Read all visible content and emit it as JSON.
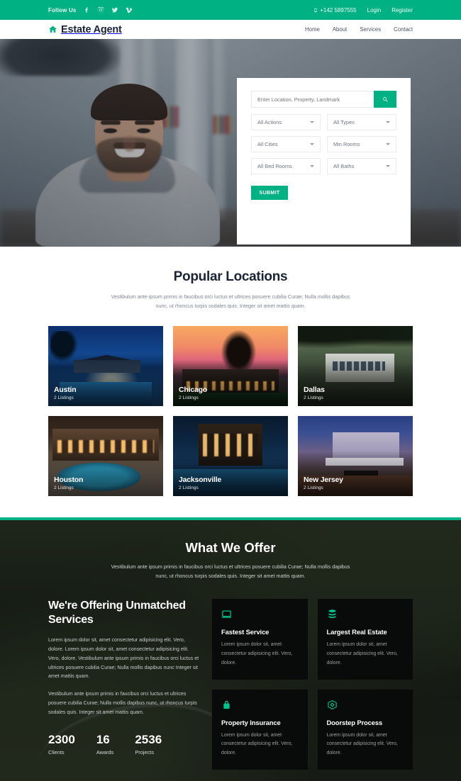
{
  "topbar": {
    "follow_label": "Follow Us",
    "socials": [
      {
        "name": "facebook-icon"
      },
      {
        "name": "instagram-icon"
      },
      {
        "name": "twitter-icon"
      },
      {
        "name": "vimeo-icon"
      }
    ],
    "phone": "+142 5897555",
    "login": "Login",
    "register": "Register",
    "bg_color": "#00b183"
  },
  "header": {
    "logo_text": "Estate Agent",
    "logo_icon": "home-icon",
    "nav": [
      {
        "label": "Home"
      },
      {
        "label": "About"
      },
      {
        "label": "Services"
      },
      {
        "label": "Contact"
      }
    ]
  },
  "hero": {
    "search": {
      "placeholder": "Enter Location, Property, Landmark",
      "value": "",
      "search_icon": "search-icon",
      "selects": [
        {
          "label": "All Actions"
        },
        {
          "label": "All Types"
        },
        {
          "label": "All Cities"
        },
        {
          "label": "Min Rooms"
        },
        {
          "label": "All Bed Rooms"
        },
        {
          "label": "All Baths"
        }
      ],
      "submit_label": "SUBMIT"
    }
  },
  "locations": {
    "title": "Popular Locations",
    "subtitle": "Vestibulum ante ipsum primis in faucibus orci luctus et ultrices posuere cubilia Curae; Nulla mollis dapibus nunc, ut rhoncus turpis sodales quis. Integer sit amet mattis quam.",
    "cards": [
      {
        "city": "Austin",
        "count": "2 Listings"
      },
      {
        "city": "Chicago",
        "count": "2 Listings"
      },
      {
        "city": "Dallas",
        "count": "2 Listings"
      },
      {
        "city": "Houston",
        "count": "2 Listings"
      },
      {
        "city": "Jacksonville",
        "count": "2 Listings"
      },
      {
        "city": "New Jersey",
        "count": "2 Listings"
      }
    ]
  },
  "offer": {
    "title": "What We Offer",
    "subtitle": "Vestibulum ante ipsum primis in faucibus orci luctus et ultrices posuere cubilia Curae; Nulla mollis dapibus nunc, ut rhoncus turpis sodales quis. Integer sit amet mattis quam.",
    "heading": "We're Offering Unmatched Services",
    "paragraph1": "Lorem ipsum dolor sit, amet consectetur adipisicing elit. Vero, dolore. Lorem ipsum dolor sit, amet consectetur adipisicing elit. Vero, dolore. Vestibulum ante ipsum primis in faucibus orci luctus et ultrices posuere cubilia Curae; Nulla mollis dapibus nunc Integer sit amet mattis quam.",
    "paragraph2": "Vestibulum ante ipsum primis in faucibus orci luctus et ultrices posuere cubilia Curae; Nulla mollis dapibus nunc, ut rhoncus turpis sodales quis. Integer sit amet mattis quam.",
    "stats": [
      {
        "number": "2300",
        "label": "Clients"
      },
      {
        "number": "16",
        "label": "Awards"
      },
      {
        "number": "2536",
        "label": "Projects"
      }
    ],
    "features": [
      {
        "icon": "laptop-icon",
        "title": "Fastest Service",
        "desc": "Lorem ipsum dolor sit, amet consectetur adipisicing elit. Vero, dolore."
      },
      {
        "icon": "database-icon",
        "title": "Largest Real Estate",
        "desc": "Lorem ipsum dolor sit, amet consectetur adipisicing elit. Vero, dolore."
      },
      {
        "icon": "lock-icon",
        "title": "Property Insurance",
        "desc": "Lorem ipsum dolor sit, amet consectetur adipisicing elit. Vero, dolore."
      },
      {
        "icon": "hexagon-icon",
        "title": "Doorstep Process",
        "desc": "Lorem ipsum dolor sit, amet consectetur adipisicing elit. Vero, dolore."
      }
    ],
    "accent_color": "#00c48c"
  }
}
